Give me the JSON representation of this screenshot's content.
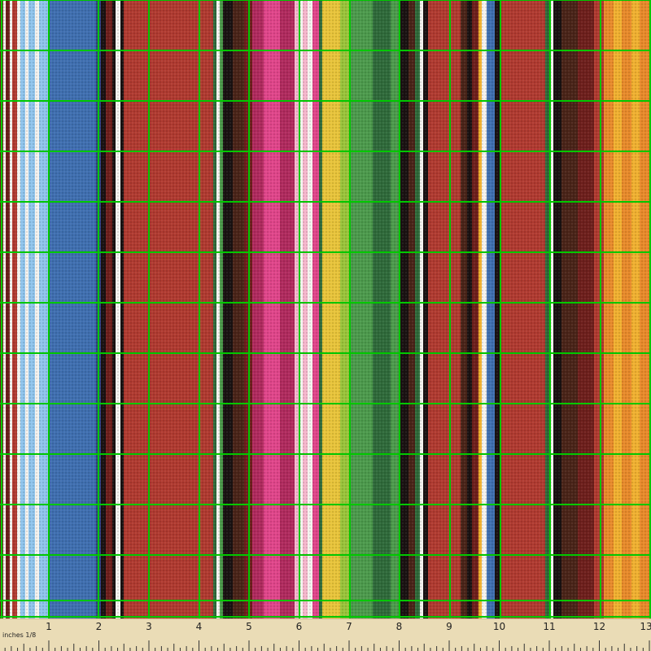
{
  "image": {
    "subject": "serape-stripe-fabric",
    "grid_color": "#00c800"
  },
  "ruler": {
    "unit_label": "inches 1/8",
    "numbers": [
      "1",
      "2",
      "3",
      "4",
      "5",
      "6",
      "7",
      "8",
      "9",
      "10",
      "11",
      "12",
      "13"
    ],
    "background": "#eadcb6"
  },
  "stripe_colors": {
    "red": "#b03a30",
    "maroon": "#6e1f1c",
    "black": "#1a1212",
    "white": "#f4f2ee",
    "light_blue": "#8fc4ec",
    "blue": "#3f6fb0",
    "navy": "#2a3f7a",
    "pink": "#e0458a",
    "magenta": "#b02a5e",
    "light_pink": "#f5b6cc",
    "yellow": "#e8c43a",
    "lime": "#9ac43a",
    "green": "#4c9a4c",
    "dark_green": "#2f6a3a",
    "orange": "#e88a2a",
    "gold": "#f0b030",
    "brown": "#4a2418"
  }
}
